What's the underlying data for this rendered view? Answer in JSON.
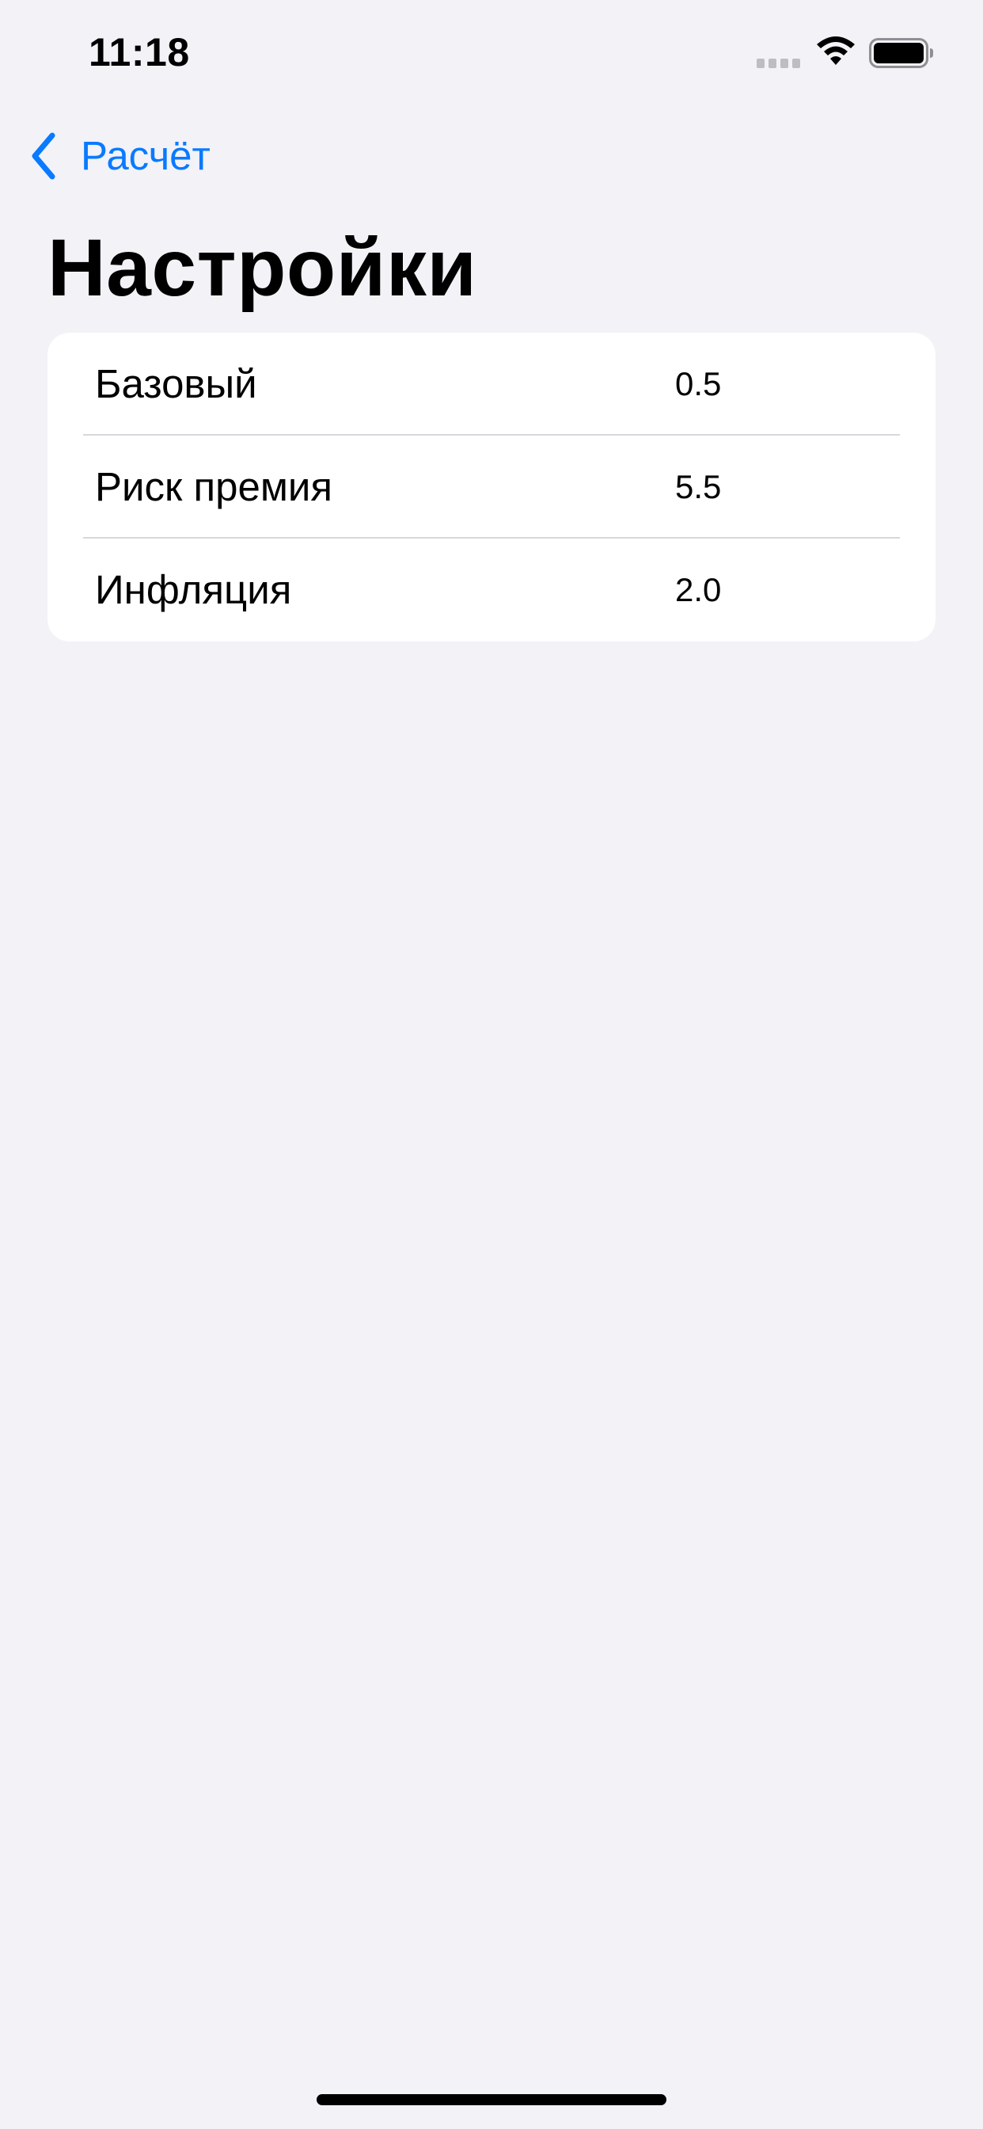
{
  "status_bar": {
    "time": "11:18",
    "icons": [
      "signal-icon",
      "wifi-icon",
      "battery-icon"
    ]
  },
  "nav": {
    "back_label": "Расчёт",
    "back_icon": "chevron-left-icon",
    "title": "Настройки"
  },
  "settings": {
    "rows": [
      {
        "label": "Базовый",
        "value": "0.5"
      },
      {
        "label": "Риск премия",
        "value": "5.5"
      },
      {
        "label": "Инфляция",
        "value": "2.0"
      }
    ]
  },
  "colors": {
    "accent": "#0A7AFF",
    "background": "#F2F2F7",
    "card": "#FFFFFF",
    "separator": "#D8D8DC"
  }
}
